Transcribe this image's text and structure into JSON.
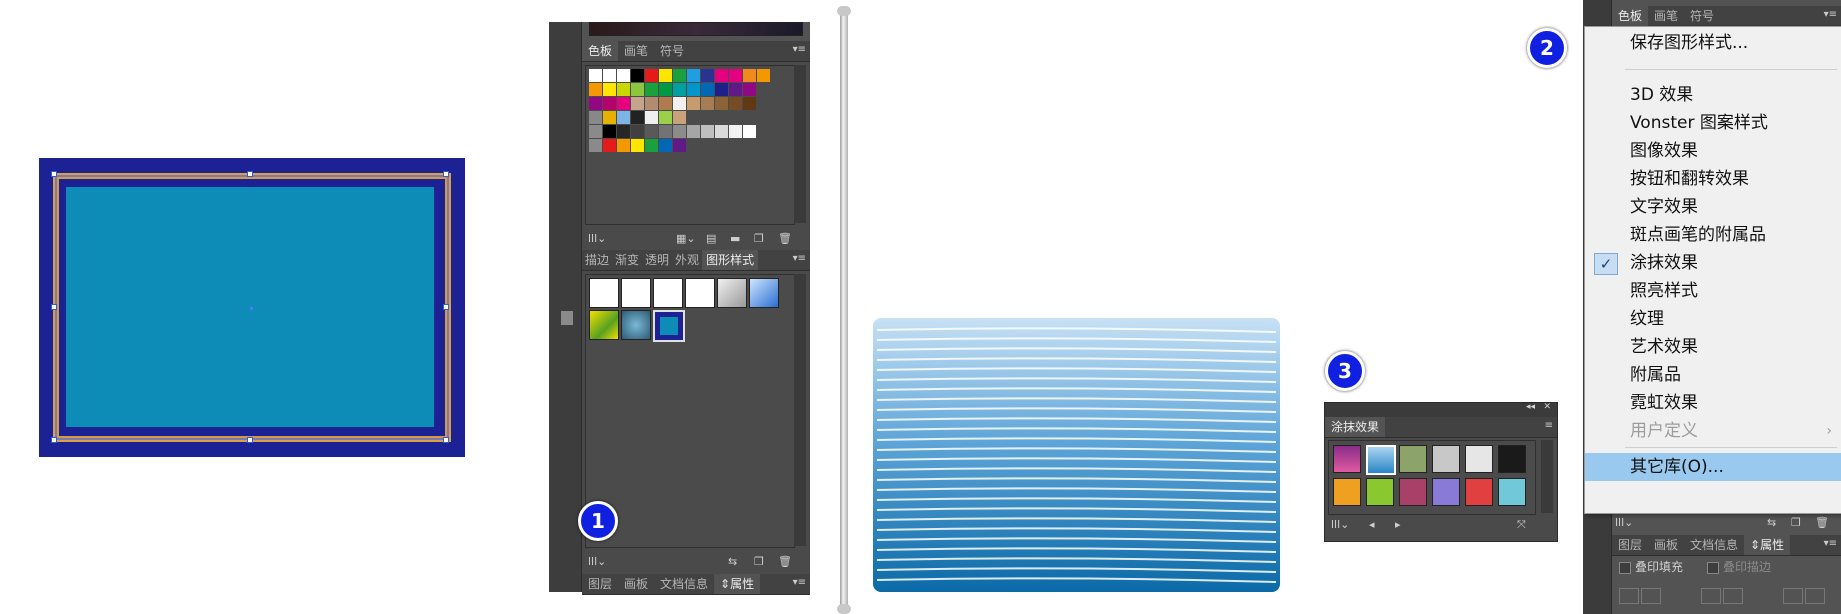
{
  "panel1": {
    "swatch_tabs": [
      "色板",
      "画笔",
      "符号"
    ],
    "swatch_tab_active": 0,
    "style_tabs": [
      "描边",
      "渐变",
      "透明",
      "外观",
      "图形样式"
    ],
    "style_tab_active": 4,
    "bottom_tabs": [
      "图层",
      "画板",
      "文档信息",
      "属性"
    ],
    "bottom_tab_active": 3,
    "menu_glyph": "▾≡",
    "toolbar_glyph": "lll⌄"
  },
  "panel3": {
    "title": "涂抹效果",
    "collapse_glyph": "◂◂",
    "close_glyph": "✕"
  },
  "right_panel": {
    "top_tabs": [
      "色板",
      "画笔",
      "符号"
    ],
    "top_tab_active": 0,
    "bottom_tabs": [
      "图层",
      "画板",
      "文档信息",
      "属性"
    ],
    "bottom_tab_active": 3,
    "checkbox_fill_label": "叠印填充",
    "checkbox_stroke_label": "叠印描边"
  },
  "menu": {
    "items": [
      {
        "label": "保存图形样式...",
        "state": "normal"
      },
      {
        "label": "3D 效果",
        "state": "normal"
      },
      {
        "label": "Vonster 图案样式",
        "state": "normal"
      },
      {
        "label": "图像效果",
        "state": "normal"
      },
      {
        "label": "按钮和翻转效果",
        "state": "normal"
      },
      {
        "label": "文字效果",
        "state": "normal"
      },
      {
        "label": "斑点画笔的附属品",
        "state": "normal"
      },
      {
        "label": "涂抹效果",
        "state": "checked"
      },
      {
        "label": "照亮样式",
        "state": "normal"
      },
      {
        "label": "纹理",
        "state": "normal"
      },
      {
        "label": "艺术效果",
        "state": "normal"
      },
      {
        "label": "附属品",
        "state": "normal"
      },
      {
        "label": "霓虹效果",
        "state": "normal"
      },
      {
        "label": "用户定义",
        "state": "disabled",
        "submenu": true
      },
      {
        "label": "其它库(O)...",
        "state": "highlighted"
      }
    ],
    "check_glyph": "✓",
    "submenu_glyph": "›"
  },
  "badges": [
    "1",
    "2",
    "3"
  ],
  "colors": {
    "artboard_bg": "#1c2294",
    "artboard_inner": "#0e8cb8",
    "panel_bg": "#535353",
    "menu_bg": "#f0f0f0",
    "menu_highlight": "#99c9ef",
    "badge_blue": "#1020e0"
  },
  "icons": [
    "library-icon",
    "new-swatch-icon",
    "folder-icon",
    "trash-icon",
    "break-link-icon",
    "new-style-icon",
    "prev-icon",
    "next-icon"
  ]
}
